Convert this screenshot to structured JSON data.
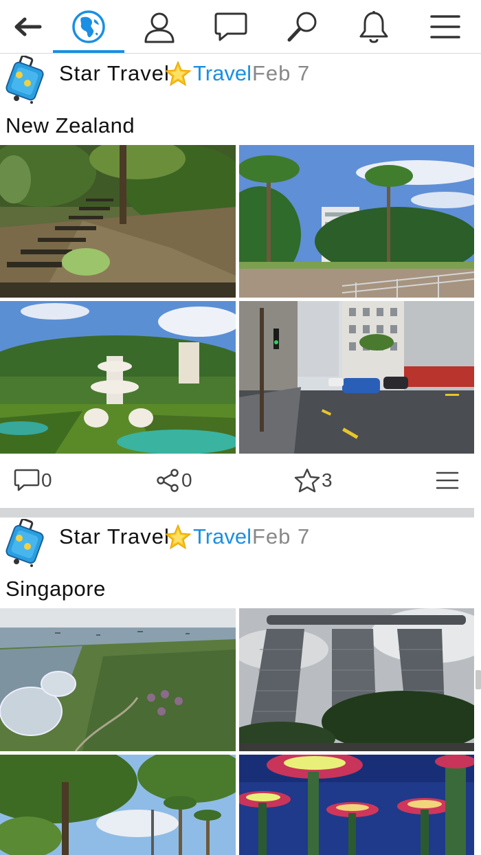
{
  "nav": {
    "items": [
      {
        "icon": "back-arrow-icon"
      },
      {
        "icon": "globe-icon",
        "active": true
      },
      {
        "icon": "profile-icon"
      },
      {
        "icon": "messages-icon"
      },
      {
        "icon": "search-icon"
      },
      {
        "icon": "notifications-icon"
      },
      {
        "icon": "menu-icon"
      }
    ],
    "accent_color": "#1a8fe3"
  },
  "posts": [
    {
      "author": "Star Travel",
      "category": "Travel",
      "date": "Feb 7",
      "title": "New Zealand",
      "photos": [
        "forest-stairs",
        "palm-park",
        "fountain-garden",
        "city-street"
      ],
      "stats": {
        "comments": "0",
        "shares": "0",
        "stars": "3"
      }
    },
    {
      "author": "Star Travel",
      "category": "Travel",
      "date": "Feb 7",
      "title": "Singapore",
      "photos": [
        "gardens-aerial",
        "marina-bay-sands",
        "palm-trees",
        "supertrees-night"
      ]
    }
  ],
  "colors": {
    "link": "#1a8fe3",
    "date": "#888888",
    "separator": "#d4d6d8"
  }
}
